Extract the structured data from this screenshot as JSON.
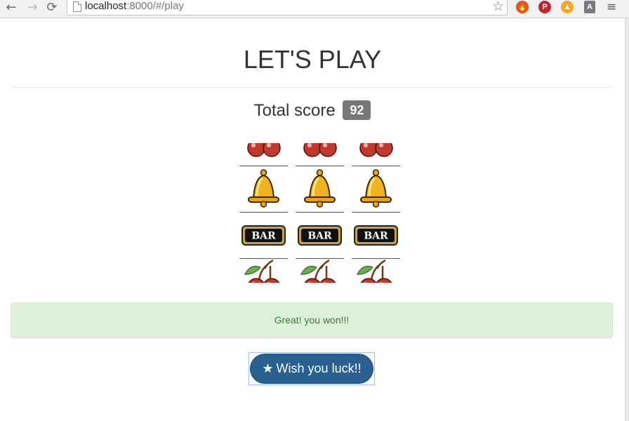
{
  "browser": {
    "url_host": "localhost",
    "url_rest": ":8000/#/play"
  },
  "page": {
    "title": "LET'S PLAY",
    "score_label": "Total score",
    "score_value": "92",
    "alert_text": "Great! you won!!!",
    "button_label": "Wish you luck!!"
  },
  "reels": [
    [
      "cherry",
      "bell",
      "bar",
      "cherry"
    ],
    [
      "cherry",
      "bell",
      "bar",
      "cherry"
    ],
    [
      "cherry",
      "bell",
      "bar",
      "cherry"
    ]
  ],
  "symbols": {
    "bar_text": "BAR"
  },
  "colors": {
    "alert_bg": "#dff0d8",
    "alert_text": "#3c763d",
    "button": "#286090",
    "badge": "#777777"
  }
}
